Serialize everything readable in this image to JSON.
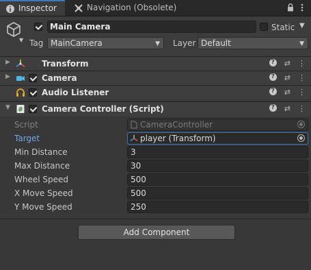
{
  "tabs": [
    {
      "label": "Inspector",
      "icon": "info-icon"
    },
    {
      "label": "Navigation (Obsolete)",
      "icon": "navigation-icon"
    }
  ],
  "tab_controls": {
    "lock_icon": "lock-icon",
    "menu_icon": "menu-dots-icon"
  },
  "header": {
    "object_active": true,
    "object_name": "Main Camera",
    "static_label": "Static",
    "static_checked": false,
    "tag_label": "Tag",
    "tag_value": "MainCamera",
    "layer_label": "Layer",
    "layer_value": "Default"
  },
  "components": [
    {
      "title": "Transform",
      "expanded": false,
      "has_checkbox": false,
      "icon": "transform-icon"
    },
    {
      "title": "Camera",
      "expanded": false,
      "has_checkbox": true,
      "checked": true,
      "icon": "camera-icon"
    },
    {
      "title": "Audio Listener",
      "expanded": false,
      "has_checkbox": true,
      "checked": true,
      "icon": "headphones-icon"
    },
    {
      "title": "Camera Controller (Script)",
      "expanded": true,
      "has_checkbox": true,
      "checked": true,
      "icon": "script-icon"
    }
  ],
  "script_properties": [
    {
      "label": "Script",
      "value": "CameraController",
      "type": "object",
      "disabled": true
    },
    {
      "label": "Target",
      "value": "player (Transform)",
      "type": "object",
      "highlighted": true
    },
    {
      "label": "Min Distance",
      "value": "3",
      "type": "number"
    },
    {
      "label": "Max Distance",
      "value": "30",
      "type": "number"
    },
    {
      "label": "Wheel Speed",
      "value": "500",
      "type": "number"
    },
    {
      "label": "X Move Speed",
      "value": "500",
      "type": "number"
    },
    {
      "label": "Y Move Speed",
      "value": "250",
      "type": "number"
    }
  ],
  "add_component_label": "Add Component",
  "colors": {
    "accent": "#3a79bb",
    "link": "#6fa8e6",
    "background": "#383838"
  }
}
